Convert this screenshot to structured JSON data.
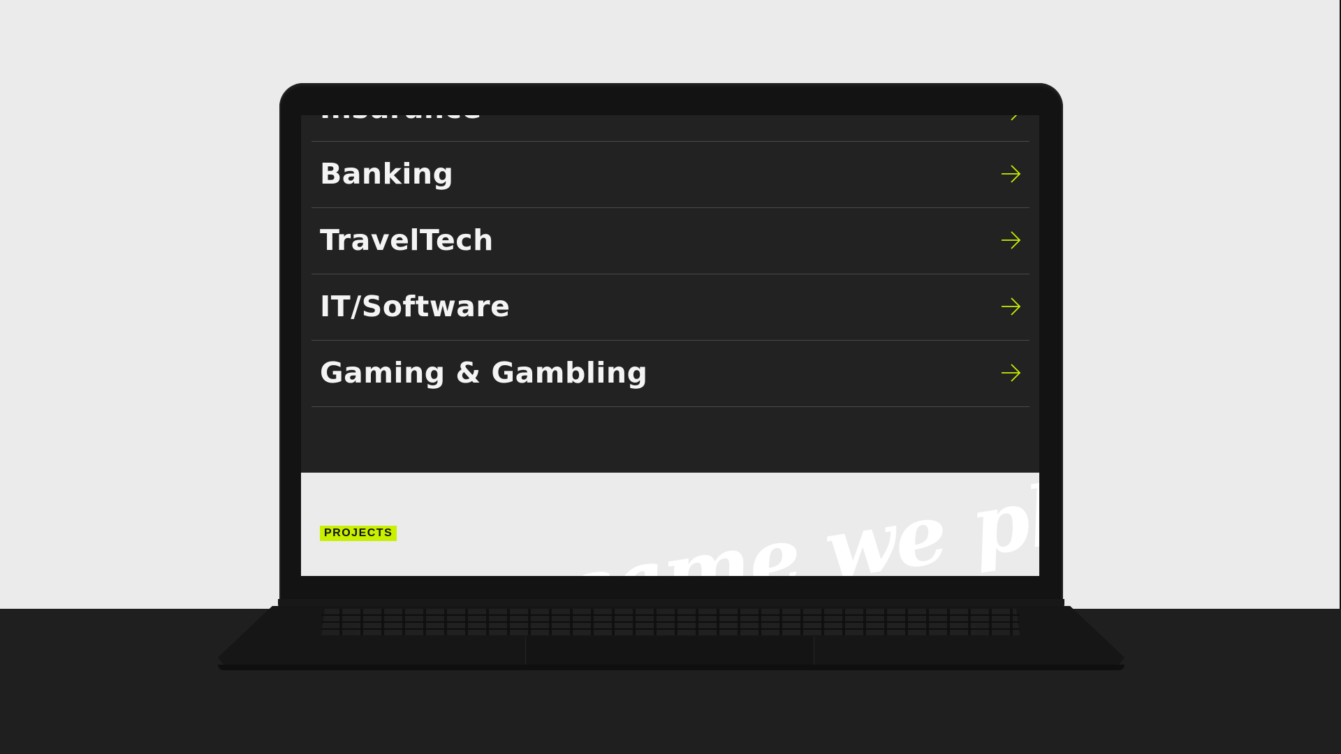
{
  "menu": {
    "items": [
      {
        "label": "Insurance",
        "icon": "arrow-right-icon"
      },
      {
        "label": "Banking",
        "icon": "arrow-right-icon"
      },
      {
        "label": "TravelTech",
        "icon": "arrow-right-icon"
      },
      {
        "label": "IT/Software",
        "icon": "arrow-right-icon"
      },
      {
        "label": "Gaming & Gambling",
        "icon": "arrow-right-icon"
      }
    ]
  },
  "projects": {
    "badge": "PROJECTS",
    "background_text": "is the game we play"
  },
  "colors": {
    "accent": "#c8f000",
    "dark_bg": "#222222",
    "light_bg": "#ebebeb",
    "text": "#f4f4f4"
  }
}
